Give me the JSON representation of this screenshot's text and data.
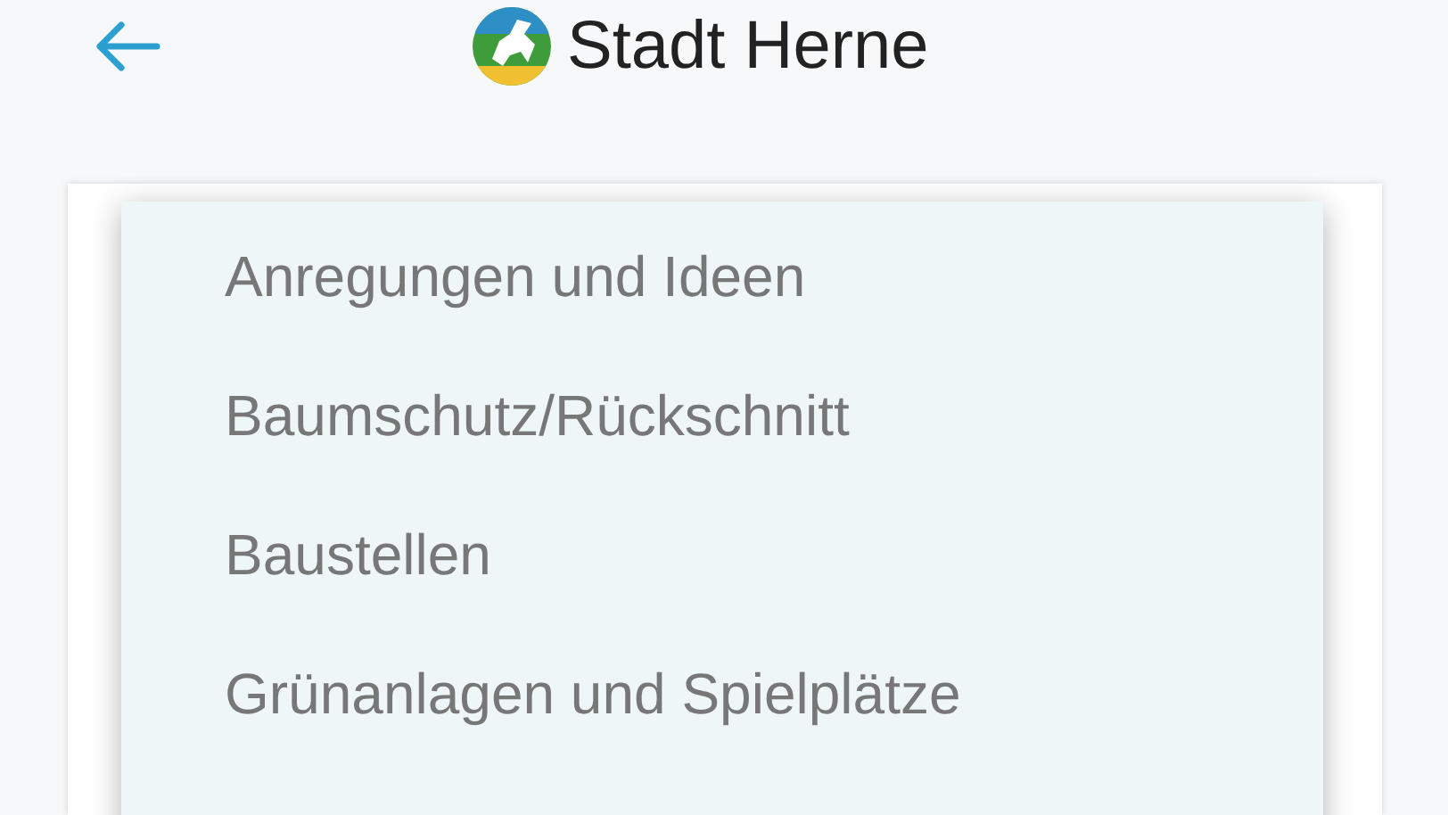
{
  "header": {
    "title": "Stadt Herne"
  },
  "menu": {
    "items": [
      {
        "label": "Anregungen und Ideen"
      },
      {
        "label": "Baumschutz/Rückschnitt"
      },
      {
        "label": "Baustellen"
      },
      {
        "label": "Grünanlagen und Spielplätze"
      }
    ]
  }
}
